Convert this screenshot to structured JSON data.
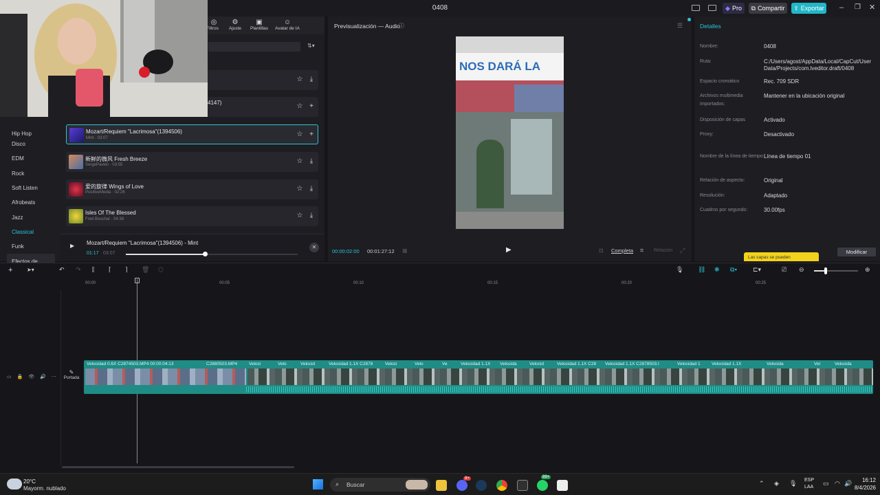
{
  "window": {
    "title": "0408"
  },
  "topbar": {
    "pro_label": "Pro",
    "share_label": "Compartir",
    "export_label": "Exportar"
  },
  "toolbar_tabs": [
    {
      "label": "Filtros"
    },
    {
      "label": "Ajuste"
    },
    {
      "label": "Plantillas"
    },
    {
      "label": "Avatar de IA"
    }
  ],
  "categories": [
    {
      "label": "Hip Hop"
    },
    {
      "label": "Disco"
    },
    {
      "label": "EDM"
    },
    {
      "label": "Rock"
    },
    {
      "label": "Soft Listen"
    },
    {
      "label": "Afrobeats"
    },
    {
      "label": "Jazz"
    },
    {
      "label": "Classical"
    },
    {
      "label": "Funk"
    },
    {
      "label": "Efectos de ..."
    }
  ],
  "tracks": [
    {
      "name": "",
      "meta": ""
    },
    {
      "name": "4147)",
      "meta": ""
    },
    {
      "name": "Mozart/Requiem \"Lacrimosa\"(1394506)",
      "meta": "Mint · 03:07"
    },
    {
      "name": "新鲜的微风 Fresh Breeze",
      "meta": "SergePavkin · 03:55"
    },
    {
      "name": "爱的旋律 Wings of Love",
      "meta": "PositiveMedia · 02:26"
    },
    {
      "name": "Isles Of The Blessed",
      "meta": "Fred Bouchal · 04:38"
    }
  ],
  "player": {
    "title": "Mozart/Requiem \"Lacrimosa\"(1394506) - Mint",
    "current": "01:17",
    "total": "03:07",
    "progress": 0.46
  },
  "preview": {
    "header": "Previsualización — Audio",
    "sign_text": "NOS DARÁ LA",
    "time_current": "00:00:02:00",
    "time_total": "00:01:27:12",
    "full_label": "Completa",
    "ratio_label": "Relación"
  },
  "details": {
    "title": "Detalles",
    "rows": [
      {
        "label": "Nombre:",
        "value": "0408"
      },
      {
        "label": "Ruta:",
        "value": "C:/Users/agost/AppData/Local/CapCut/User Data/Projects/com.lveditor.draft/0408"
      },
      {
        "label": "Espacio cromático",
        "value": "Rec. 709 SDR"
      },
      {
        "label": "Archivos multimedia importados:",
        "value": "Mantener en la ubicación original"
      },
      {
        "label": "Disposición de capas",
        "value": "Activado"
      },
      {
        "label": "Proxy:",
        "value": "Desactivado"
      },
      {
        "label": "Nombre de la línea de tiempo",
        "value": "Línea de tiempo 01"
      },
      {
        "label": "Relación de aspecto:",
        "value": "Original"
      },
      {
        "label": "Resolución:",
        "value": "Adaptado"
      },
      {
        "label": "Cuadros por segundo:",
        "value": "30.00fps"
      }
    ],
    "tooltip": "Las capas se pueden",
    "modify_label": "Modificar"
  },
  "timeline": {
    "ticks": [
      "00:00",
      "00:05",
      "00:10",
      "00:15",
      "00:20",
      "00:25"
    ],
    "cover_label": "Portada",
    "clip_labels": [
      "Velocidad 0.6X  C2874503.MP4  00:00:04:13",
      "C2880503.MP4",
      "Veloci",
      "Velo",
      "Velocid",
      "Velocidad 1.1X  C2878",
      "Veloci",
      "Velo",
      "Ve",
      "Velocidad 1.1X",
      "Velocida",
      "Velocid",
      "Velocidad 1.1X  C28",
      "Velocidad 1.1X  C2878503.I",
      "Velocidad 1",
      "Velocidad 1.1X",
      "Velocida",
      "Vel",
      "Velocida"
    ]
  },
  "taskbar": {
    "weather_temp": "20°C",
    "weather_desc": "Mayorm. nublado",
    "search_placeholder": "Buscar",
    "lang1": "ESP",
    "lang2": "LAA",
    "time": "16:12",
    "date": "8/4/2026",
    "badge1": "9+",
    "badge2": "99+"
  },
  "colors": {
    "accent": "#2ec4d8",
    "clip": "#1f8c86",
    "pro": "#6b59e8",
    "tooltip": "#f2d21b"
  }
}
